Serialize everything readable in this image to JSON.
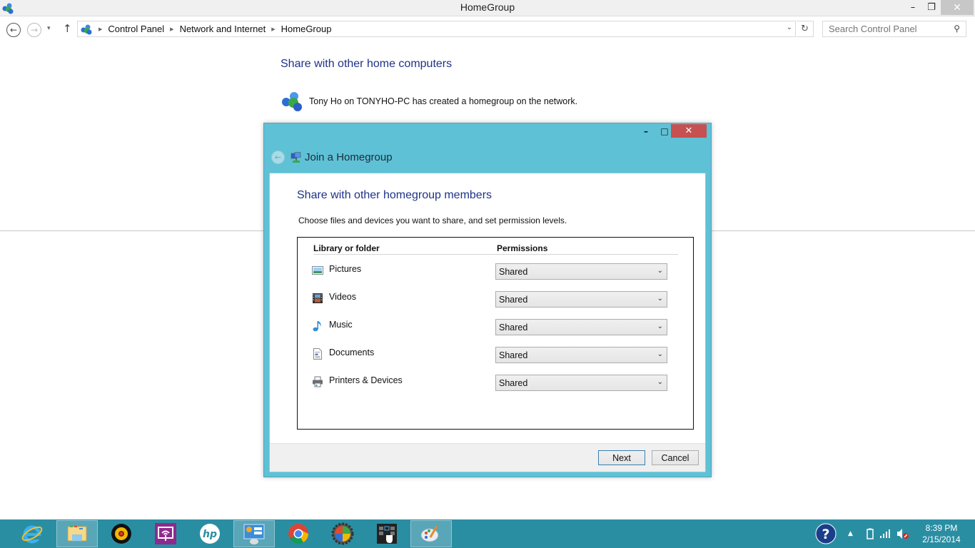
{
  "window": {
    "title": "HomeGroup",
    "minimize_label": "–",
    "maximize_label": "❐",
    "close_label": "✕"
  },
  "nav": {
    "back_icon": "←",
    "forward_icon": "→",
    "recent_icon": "▾",
    "up_icon": "↑",
    "breadcrumbs": [
      "Control Panel",
      "Network and Internet",
      "HomeGroup"
    ],
    "breadcrumb_sep": "▶",
    "address_dropdown": "⌄",
    "refresh_icon": "↻",
    "search_placeholder": "Search Control Panel",
    "search_icon": "⚲"
  },
  "main": {
    "heading": "Share with other home computers",
    "homegroup_message": "Tony Ho on TONYHO-PC has created a homegroup on the network."
  },
  "dialog": {
    "minimize_label": "–",
    "maximize_label": "□",
    "close_label": "✕",
    "back_icon": "←",
    "title": "Join a Homegroup",
    "heading": "Share with other homegroup members",
    "instructions": "Choose files and devices you want to share, and set permission levels.",
    "columns": {
      "library": "Library or folder",
      "permissions": "Permissions"
    },
    "rows": [
      {
        "label": "Pictures",
        "icon": "pictures-icon",
        "permission": "Shared"
      },
      {
        "label": "Videos",
        "icon": "videos-icon",
        "permission": "Shared"
      },
      {
        "label": "Music",
        "icon": "music-icon",
        "permission": "Shared"
      },
      {
        "label": "Documents",
        "icon": "documents-icon",
        "permission": "Shared"
      },
      {
        "label": "Printers & Devices",
        "icon": "printer-icon",
        "permission": "Shared"
      }
    ],
    "dropdown_caret": "⌄",
    "next_label": "Next",
    "cancel_label": "Cancel"
  },
  "taskbar": {
    "apps": [
      {
        "name": "internet-explorer",
        "active": false
      },
      {
        "name": "file-explorer",
        "active": true
      },
      {
        "name": "webcam",
        "active": false
      },
      {
        "name": "wireless-display",
        "active": false
      },
      {
        "name": "hp",
        "active": false
      },
      {
        "name": "control-panel",
        "active": true
      },
      {
        "name": "chrome",
        "active": false
      },
      {
        "name": "app-gear",
        "active": false
      },
      {
        "name": "touch-app",
        "active": false
      },
      {
        "name": "paint",
        "active": true
      }
    ],
    "help_icon": "?",
    "tray_expand": "▲",
    "time": "8:39 PM",
    "date": "2/15/2014"
  },
  "colors": {
    "accent_blue": "#1e3287",
    "dialog_frame": "#5fc1d6",
    "dialog_close": "#c75050",
    "taskbar": "#2a8ea3"
  }
}
